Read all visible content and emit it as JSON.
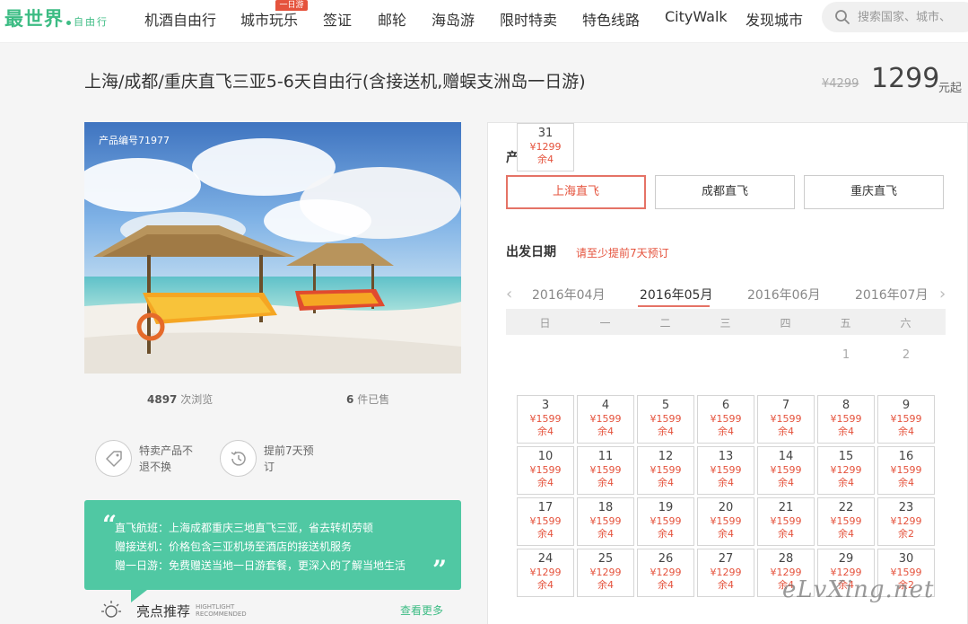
{
  "logo": {
    "main": "最世界",
    "sub": "自由行"
  },
  "nav": [
    {
      "label": "机酒自由行"
    },
    {
      "label": "城市玩乐"
    },
    {
      "label": "签证"
    },
    {
      "label": "邮轮"
    },
    {
      "label": "海岛游"
    },
    {
      "label": "限时特卖"
    },
    {
      "label": "特色线路"
    },
    {
      "label": "CityWalk"
    },
    {
      "label": "发现城市"
    }
  ],
  "nav_badge": "一日游",
  "search": {
    "placeholder": "搜索国家、城市、"
  },
  "product": {
    "title": "上海/成都/重庆直飞三亚5-6天自由行(含接送机,赠蜈支洲岛一日游)",
    "old_price": "¥4299",
    "price": "1299",
    "price_unit": "元起",
    "code": "产品编号71977",
    "views": "4897",
    "views_label": "次浏览",
    "sold": "6",
    "sold_label": "件已售"
  },
  "promises": [
    {
      "text": "特卖产品不退不换",
      "icon": "tag-icon"
    },
    {
      "text": "提前7天预订",
      "icon": "clock-icon"
    }
  ],
  "highlights": [
    "直飞航班：上海成都重庆三地直飞三亚，省去转机劳顿",
    "赠接送机：价格包含三亚机场至酒店的接送机服务",
    "赠一日游：免费赠送当地一日游套餐，更深入的了解当地生活"
  ],
  "section": {
    "title": "亮点推荐",
    "en_line1": "HIGHTLIGHT",
    "en_line2": "RECOMMENDED",
    "more": "查看更多"
  },
  "booking": {
    "type_label": "产品类型",
    "types": [
      {
        "label": "上海直飞",
        "selected": true
      },
      {
        "label": "成都直飞",
        "selected": false
      },
      {
        "label": "重庆直飞",
        "selected": false
      }
    ],
    "date_label": "出发日期",
    "date_note": "请至少提前7天预订",
    "months": [
      {
        "label": "2016年04月"
      },
      {
        "label": "2016年05月",
        "selected": true
      },
      {
        "label": "2016年06月"
      },
      {
        "label": "2016年07月"
      }
    ],
    "weekdays": [
      "日",
      "一",
      "二",
      "三",
      "四",
      "五",
      "六"
    ],
    "days": [
      {
        "day": "1",
        "price": "",
        "left": ""
      },
      {
        "day": "2",
        "price": "",
        "left": ""
      },
      {
        "day": "3",
        "price": "¥1599",
        "left": "余4"
      },
      {
        "day": "4",
        "price": "¥1599",
        "left": "余4"
      },
      {
        "day": "5",
        "price": "¥1599",
        "left": "余4"
      },
      {
        "day": "6",
        "price": "¥1599",
        "left": "余4"
      },
      {
        "day": "7",
        "price": "¥1599",
        "left": "余4"
      },
      {
        "day": "8",
        "price": "¥1599",
        "left": "余4"
      },
      {
        "day": "9",
        "price": "¥1599",
        "left": "余4"
      },
      {
        "day": "10",
        "price": "¥1599",
        "left": "余4"
      },
      {
        "day": "11",
        "price": "¥1599",
        "left": "余4"
      },
      {
        "day": "12",
        "price": "¥1599",
        "left": "余4"
      },
      {
        "day": "13",
        "price": "¥1599",
        "left": "余4"
      },
      {
        "day": "14",
        "price": "¥1599",
        "left": "余4"
      },
      {
        "day": "15",
        "price": "¥1299",
        "left": "余4"
      },
      {
        "day": "16",
        "price": "¥1599",
        "left": "余4"
      },
      {
        "day": "17",
        "price": "¥1599",
        "left": "余4"
      },
      {
        "day": "18",
        "price": "¥1599",
        "left": "余4"
      },
      {
        "day": "19",
        "price": "¥1599",
        "left": "余4"
      },
      {
        "day": "20",
        "price": "¥1599",
        "left": "余4"
      },
      {
        "day": "21",
        "price": "¥1599",
        "left": "余4"
      },
      {
        "day": "22",
        "price": "¥1599",
        "left": "余4"
      },
      {
        "day": "23",
        "price": "¥1299",
        "left": "余2"
      },
      {
        "day": "24",
        "price": "¥1299",
        "left": "余4"
      },
      {
        "day": "25",
        "price": "¥1299",
        "left": "余4"
      },
      {
        "day": "26",
        "price": "¥1299",
        "left": "余4"
      },
      {
        "day": "27",
        "price": "¥1299",
        "left": "余4"
      },
      {
        "day": "28",
        "price": "¥1299",
        "left": "余4"
      },
      {
        "day": "29",
        "price": "¥1299",
        "left": "余4"
      },
      {
        "day": "30",
        "price": "¥1599",
        "left": "余2"
      },
      {
        "day": "31",
        "price": "¥1299",
        "left": "余4"
      }
    ]
  },
  "watermark": "eLvXing.net",
  "colors": {
    "brand_green": "#3dbc84",
    "accent_red": "#e5533d",
    "highlight_bg": "#50c8a3"
  }
}
